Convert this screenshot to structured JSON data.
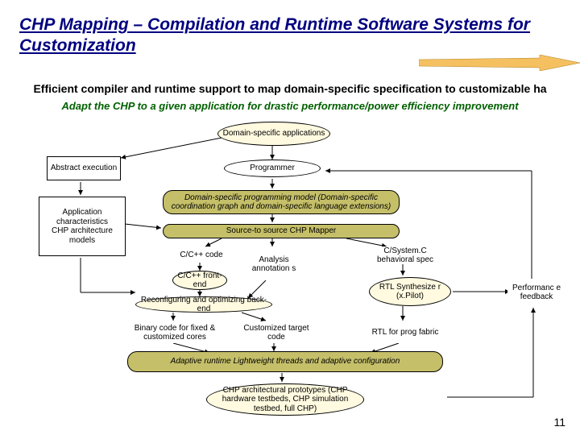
{
  "title": "CHP Mapping – Compilation and Runtime Software Systems for Customization",
  "line1": "Efficient compiler and runtime support to map domain-specific specification to customizable ha",
  "line2": "Adapt the CHP to a given application for drastic performance/power efficiency improvement",
  "nodes": {
    "domain_apps": "Domain-specific applications",
    "abstract_exec": "Abstract execution",
    "programmer": "Programmer",
    "app_char": "Application characteristics\nCHP architecture models",
    "prog_model": "Domain-specific programming model\n(Domain-specific coordination graph and domain-specific language extensions)",
    "chp_mapper": "Source-to source CHP Mapper",
    "cc_code": "C/C++ code",
    "analysis": "Analysis annotation s",
    "behavioral": "C/System.C behavioral spec",
    "cc_frontend": "C/C++ front-end",
    "backend": "Reconfiguring and optimizing back-end",
    "rtl_synth": "RTL Synthesize r (x.Pilot)",
    "perf_feedback": "Performanc e feedback",
    "binary": "Binary code for fixed & customized cores",
    "custom_target": "Customized target code",
    "rtl_prog": "RTL for prog fabric",
    "runtime": "Adaptive runtime\nLightweight threads and adaptive configuration",
    "prototypes": "CHP architectural prototypes (CHP hardware testbeds, CHP simulation testbed, full CHP)"
  },
  "page": "11"
}
